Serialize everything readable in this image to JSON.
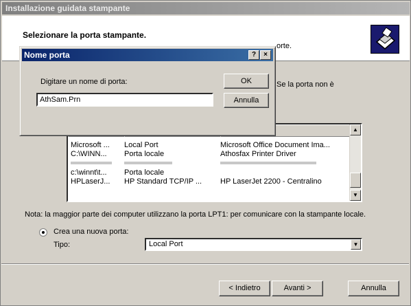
{
  "wizard": {
    "title": "Installazione guidata stampante",
    "header_title": "Selezionare la porta stampante.",
    "header_desc_tail": "orte.",
    "body_text_right": "Se la porta non è",
    "note": "Nota: la maggior parte dei computer utilizzano la porta LPT1: per comunicare con la stampante locale.",
    "radio_create_label": "Crea una nuova porta:",
    "type_label": "Tipo:",
    "type_value": "Local Port",
    "back_button": "< Indietro",
    "next_button": "Avanti >",
    "cancel_button": "Annulla"
  },
  "ports": [
    {
      "port": "Microsoft ...",
      "description": "Local Port",
      "printer": "Microsoft Office Document Ima..."
    },
    {
      "port": "C:\\WINN...",
      "description": "Porta locale",
      "printer": "Athosfax Printer Driver"
    },
    {
      "port": "c:\\winnt\\t...",
      "description": "Porta locale",
      "printer": ""
    },
    {
      "port": "HPLaserJ...",
      "description": "HP Standard TCP/IP ...",
      "printer": "HP LaserJet 2200 - Centralino"
    }
  ],
  "dialog": {
    "title": "Nome porta",
    "help_button": "?",
    "close_button": "×",
    "prompt": "Digitare un nome di porta:",
    "input_value": "AthSam.Prn",
    "ok_button": "OK",
    "cancel_button": "Annulla"
  },
  "colors": {
    "dialog_title_start": "#0a246a",
    "dialog_title_end": "#3a6ea5",
    "window_face": "#d4d0c8",
    "logo_bg": "#1a1a6e"
  }
}
